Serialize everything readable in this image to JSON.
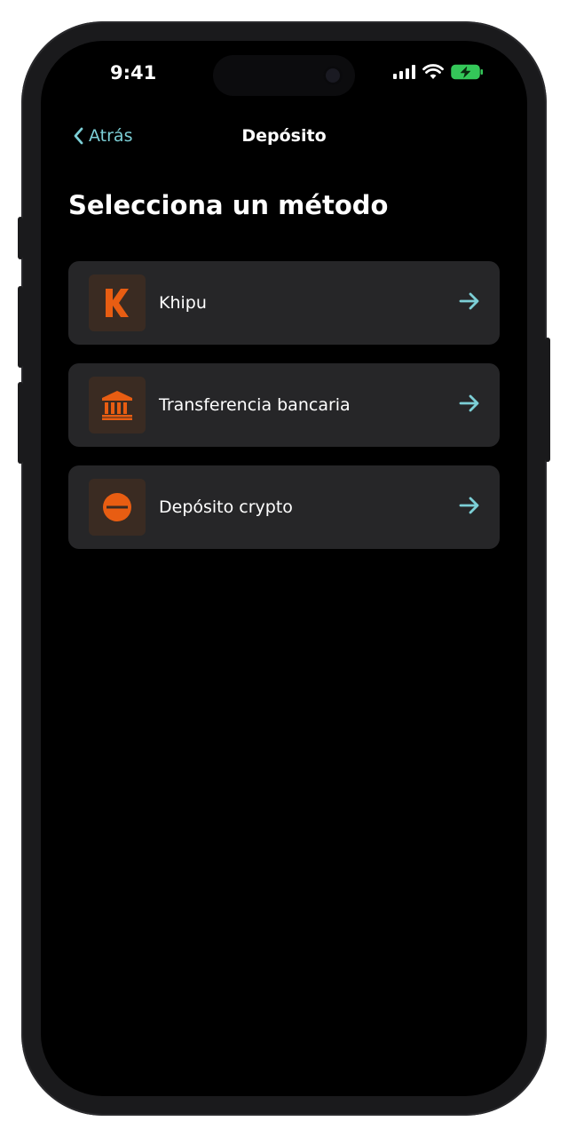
{
  "status_bar": {
    "time": "9:41"
  },
  "nav": {
    "back_label": "Atrás",
    "title": "Depósito"
  },
  "heading": "Selecciona un método",
  "methods": [
    {
      "label": "Khipu",
      "icon": "khipu-k-icon"
    },
    {
      "label": "Transferencia bancaria",
      "icon": "bank-icon"
    },
    {
      "label": "Depósito crypto",
      "icon": "crypto-coin-icon"
    }
  ],
  "colors": {
    "accent": "#7ccfd6",
    "icon_orange": "#e85d12",
    "card_bg": "#262628",
    "icon_bg": "#3a2b22"
  }
}
